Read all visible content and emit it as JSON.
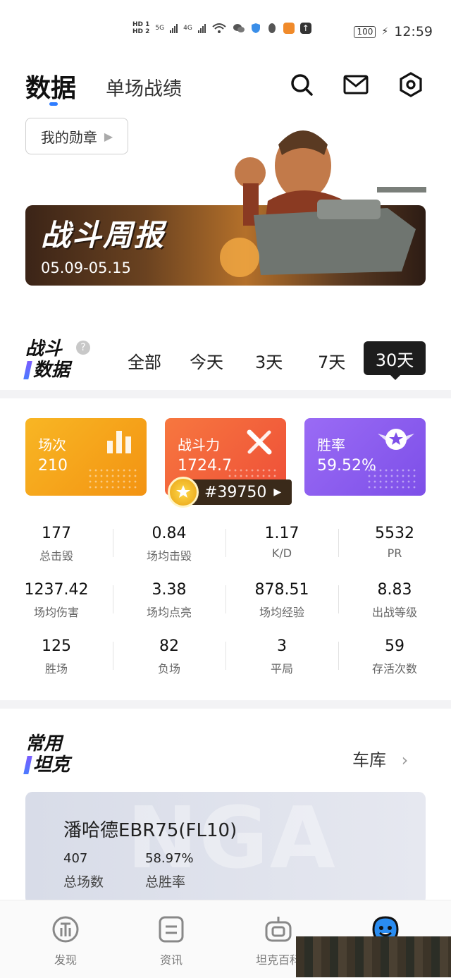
{
  "status_bar": {
    "hd1": "HD 1",
    "hd2": "HD 2",
    "net1": "5G",
    "net2": "4G",
    "battery": "100",
    "time": "12:59"
  },
  "header": {
    "title": "数据",
    "sub_tab": "单场战绩"
  },
  "medal_button": {
    "label": "我的勋章"
  },
  "banner": {
    "title": "战斗周报",
    "date_range": "05.09-05.15"
  },
  "battle_data": {
    "title_line1": "战斗",
    "title_line2": "数据",
    "help": "?",
    "filters": [
      "全部",
      "今天",
      "3天",
      "7天",
      "30天"
    ],
    "active_filter": "30天"
  },
  "cards": {
    "battles": {
      "label": "场次",
      "value": "210",
      "color": "#f7a21b"
    },
    "power": {
      "label": "战斗力",
      "value": "1724.7",
      "color": "#f2643a"
    },
    "winrate": {
      "label": "胜率",
      "value": "59.52%",
      "color": "#8a5cf0"
    },
    "rank": "#39750"
  },
  "stats": [
    {
      "value": "177",
      "label": "总击毁"
    },
    {
      "value": "0.84",
      "label": "场均击毁"
    },
    {
      "value": "1.17",
      "label": "K/D"
    },
    {
      "value": "5532",
      "label": "PR"
    },
    {
      "value": "1237.42",
      "label": "场均伤害"
    },
    {
      "value": "3.38",
      "label": "场均点亮"
    },
    {
      "value": "878.51",
      "label": "场均经验"
    },
    {
      "value": "8.83",
      "label": "出战等级"
    },
    {
      "value": "125",
      "label": "胜场"
    },
    {
      "value": "82",
      "label": "负场"
    },
    {
      "value": "3",
      "label": "平局"
    },
    {
      "value": "59",
      "label": "存活次数"
    }
  ],
  "common_tanks": {
    "title_line1": "常用",
    "title_line2": "坦克",
    "garage_link": "车库",
    "watermark": "NGA",
    "tank": {
      "name": "潘哈德EBR75(FL10)",
      "battles": "407",
      "battles_label": "总场数",
      "winrate": "58.97%",
      "winrate_label": "总胜率"
    }
  },
  "bottom_nav": [
    {
      "label": "发现",
      "icon": "discover-icon"
    },
    {
      "label": "资讯",
      "icon": "news-icon"
    },
    {
      "label": "坦克百科",
      "icon": "tank-wiki-icon"
    },
    {
      "label": "",
      "icon": "profile-mascot-icon"
    }
  ]
}
